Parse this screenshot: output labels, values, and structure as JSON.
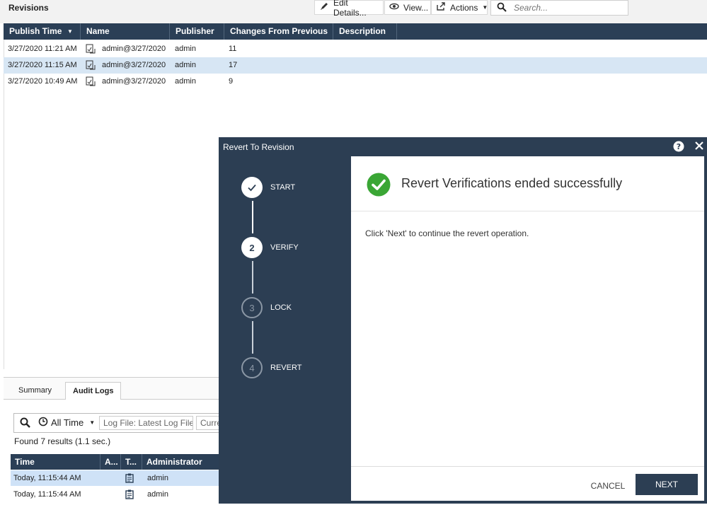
{
  "toolbar": {
    "title": "Revisions",
    "edit_details": "Edit Details...",
    "view": "View...",
    "actions": "Actions",
    "search_placeholder": "Search..."
  },
  "revisions_table": {
    "columns": [
      "Publish Time",
      "Name",
      "Publisher",
      "Changes From Previous",
      "Description"
    ],
    "rows": [
      {
        "publish_time": "3/27/2020 11:21 AM",
        "name": "admin@3/27/2020",
        "publisher": "admin",
        "changes": "11",
        "description": ""
      },
      {
        "publish_time": "3/27/2020 11:15 AM",
        "name": "admin@3/27/2020",
        "publisher": "admin",
        "changes": "17",
        "description": ""
      },
      {
        "publish_time": "3/27/2020 10:49 AM",
        "name": "admin@3/27/2020",
        "publisher": "admin",
        "changes": "9",
        "description": ""
      }
    ]
  },
  "bottom_panel": {
    "tabs": [
      "Summary",
      "Audit Logs"
    ],
    "active_tab": "Audit Logs",
    "time_filter": "All Time",
    "log_file": "Log File: Latest Log File",
    "current_partial": "Curre",
    "found_text": "Found 7 results (1.1 sec.)",
    "columns": [
      "Time",
      "A...",
      "T...",
      "Administrator"
    ],
    "rows": [
      {
        "time": "Today, 11:15:44 AM",
        "administrator": "admin"
      },
      {
        "time": "Today, 11:15:44 AM",
        "administrator": "admin"
      }
    ]
  },
  "dialog": {
    "title": "Revert To Revision",
    "steps": [
      {
        "number": "✓",
        "label": "START",
        "state": "done"
      },
      {
        "number": "2",
        "label": "VERIFY",
        "state": "active"
      },
      {
        "number": "3",
        "label": "LOCK",
        "state": "pending"
      },
      {
        "number": "4",
        "label": "REVERT",
        "state": "pending"
      }
    ],
    "success_title": "Revert Verifications ended successfully",
    "instruction": "Click 'Next' to continue the revert operation.",
    "cancel_label": "CANCEL",
    "next_label": "NEXT"
  },
  "colors": {
    "header_bg": "#2b3f56",
    "dialog_bg": "#2c3e53",
    "success_green": "#3aa635",
    "selected_row": "#d7e6f4"
  }
}
